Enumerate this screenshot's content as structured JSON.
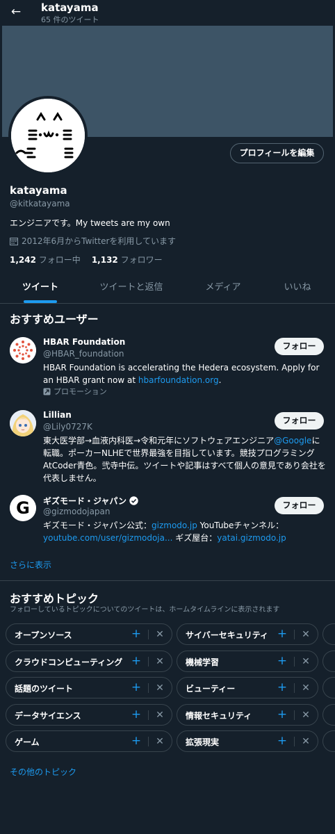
{
  "header": {
    "name": "katayama",
    "tweet_count": "65 件のツイート"
  },
  "profile": {
    "edit_button": "プロフィールを編集",
    "name": "katayama",
    "handle": "@kitkatayama",
    "bio": "エンジニアです。My tweets are my own",
    "joined": "2012年6月からTwitterを利用しています",
    "following_count": "1,242",
    "following_label": "フォロー中",
    "followers_count": "1,132",
    "followers_label": "フォロワー"
  },
  "tabs": [
    {
      "label": "ツイート",
      "active": true
    },
    {
      "label": "ツイートと返信",
      "active": false
    },
    {
      "label": "メディア",
      "active": false
    },
    {
      "label": "いいね",
      "active": false
    }
  ],
  "who_to_follow": {
    "title": "おすすめユーザー",
    "follow_label": "フォロー",
    "show_more": "さらに表示",
    "users": [
      {
        "name": "HBAR Foundation",
        "handle": "@HBAR_foundation",
        "bio_pre": "HBAR Foundation is accelerating the Hedera ecosystem. Apply for an HBAR grant now at ",
        "bio_link": "hbarfoundation.org",
        "bio_post": ".",
        "promo": "プロモーション"
      },
      {
        "name": "Lillian",
        "handle": "@Lily0727K",
        "bio_pre": "東大医学部→血液内科医→令和元年にソフトウェアエンジニア",
        "bio_link": "@Google",
        "bio_post": "に転職。ポーカーNLHEで世界最強を目指しています。競技プログラミングAtCoder青色。弐寺中伝。ツイートや記事はすべて個人の意見であり会社を代表しません。"
      },
      {
        "name": "ギズモード・ジャパン",
        "handle": "@gizmodojapan",
        "bio_pre": "ギズモード・ジャパン公式：",
        "bio_link": "gizmodo.jp",
        "bio_mid": " YouTubeチャンネル：",
        "bio_link2": "youtube.com/user/gizmodoja...",
        "bio_mid2": " ギズ屋台：",
        "bio_link3": "yatai.gizmodo.jp"
      }
    ]
  },
  "topics": {
    "title": "おすすめトピック",
    "subtitle": "フォローしているトピックについてのツイートは、ホームタイムラインに表示されます",
    "left": [
      "オープンソース",
      "クラウドコンピューティング",
      "話題のツイート",
      "データサイエンス",
      "ゲーム"
    ],
    "right": [
      "サイバーセキュリティ",
      "機械学習",
      "ビューティー",
      "情報セキュリティ",
      "拡張現実"
    ],
    "more": "その他のトピック"
  },
  "colors": {
    "background": "#15202b",
    "accent": "#1d9bf0",
    "muted": "#8899a6",
    "banner": "#3d5466"
  }
}
